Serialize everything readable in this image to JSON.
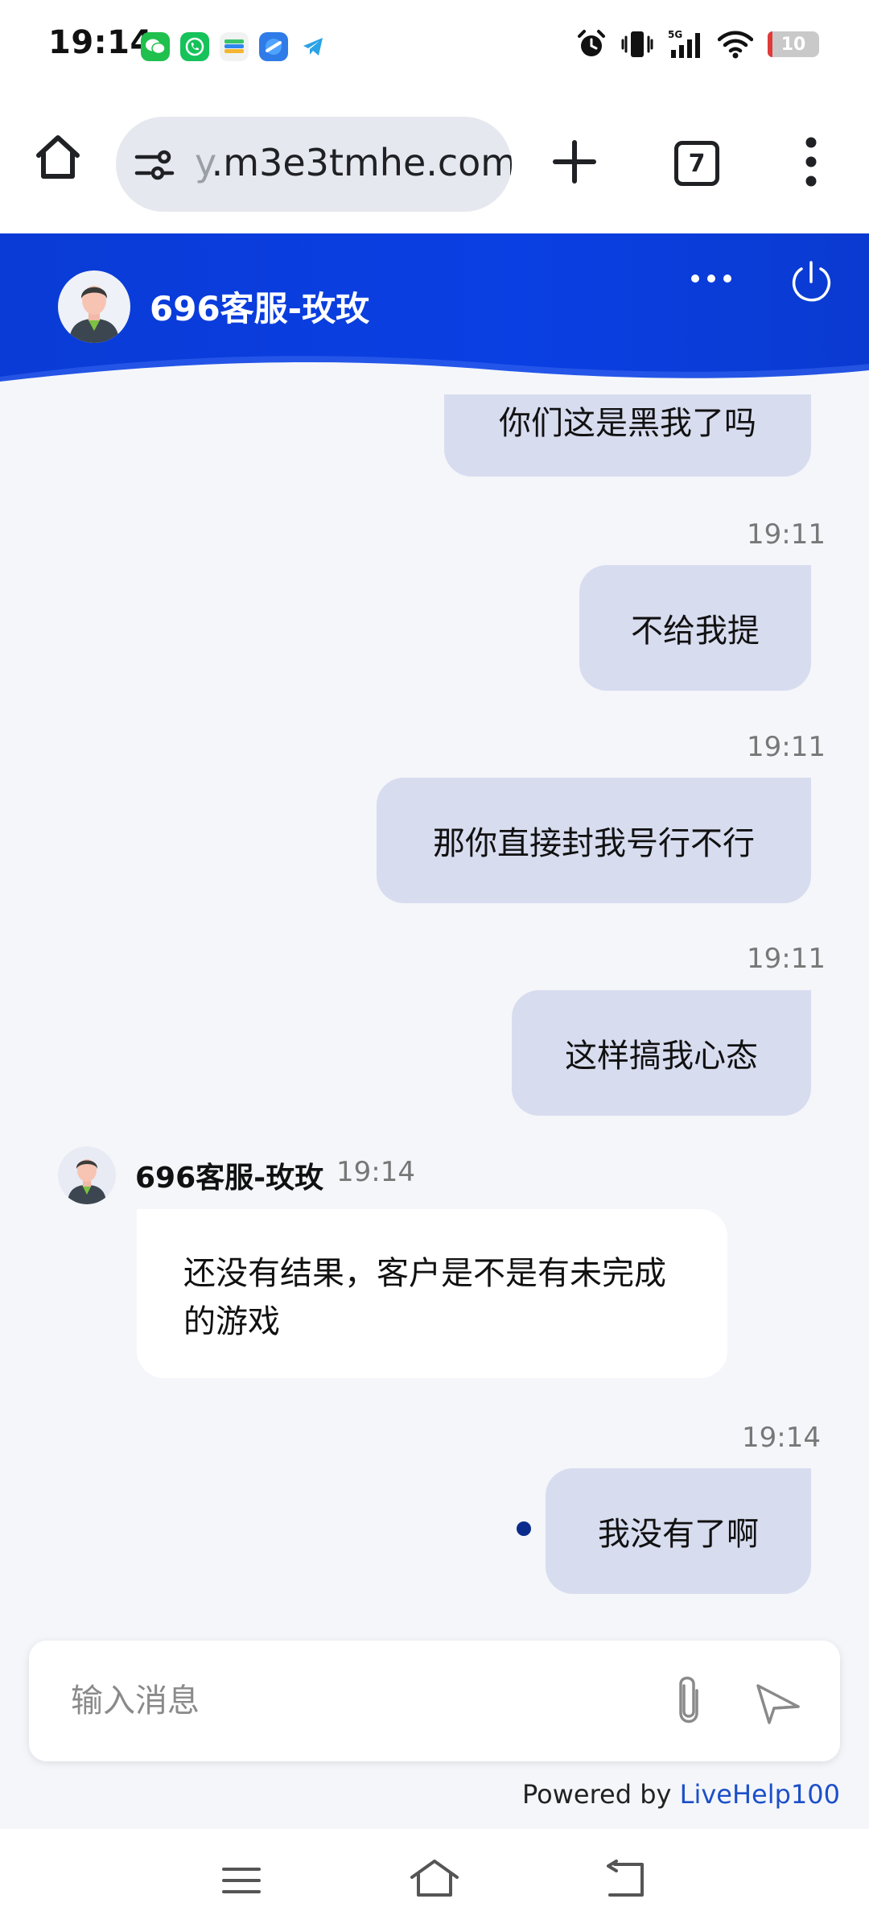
{
  "status_bar": {
    "time": "19:14",
    "notification_icons": [
      "wechat-icon",
      "phone-app-icon",
      "wallet-icon",
      "browser-app-icon",
      "telegram-icon"
    ],
    "system_icons": [
      "alarm-icon",
      "vibrate-icon",
      "signal-5g-icon",
      "wifi-icon"
    ],
    "battery_level": "10",
    "battery_color": "#e03a3a"
  },
  "browser": {
    "url_faded_prefix": "y",
    "url_rest": ".m3e3tmhe.com",
    "tab_count": "7"
  },
  "chat": {
    "header_title": "696客服-玫玫",
    "header_color": "#0a3fe3",
    "messages": [
      {
        "direction": "out",
        "text": "你们这是黑我了吗"
      },
      {
        "direction": "out",
        "time": "19:11",
        "text": "不给我提"
      },
      {
        "direction": "out",
        "time": "19:11",
        "text": "那你直接封我号行不行"
      },
      {
        "direction": "out",
        "time": "19:11",
        "text": "这样搞我心态"
      },
      {
        "direction": "in",
        "sender": "696客服-玫玫",
        "time": "19:14",
        "text": "还没有结果，客户是不是有未完成的游戏"
      },
      {
        "direction": "out",
        "time": "19:14",
        "text": "我没有了啊",
        "status": "sent"
      }
    ]
  },
  "composer": {
    "placeholder": "输入消息"
  },
  "footer": {
    "powered_by": "Powered by",
    "brand": "LiveHelp100",
    "brand_color": "#1d4fc8"
  }
}
